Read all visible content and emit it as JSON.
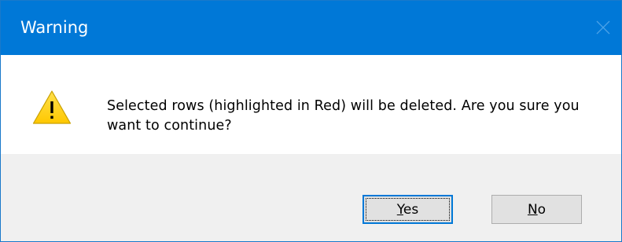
{
  "dialog": {
    "title": "Warning",
    "close_icon": "close-icon",
    "icon": "warning-triangle-icon",
    "message": "Selected rows (highlighted in Red) will be deleted. Are you sure you want to continue?",
    "buttons": {
      "yes": {
        "mnemonic": "Y",
        "rest": "es"
      },
      "no": {
        "mnemonic": "N",
        "rest": "o"
      }
    }
  },
  "colors": {
    "titlebar": "#0078d7",
    "footer": "#f0f0f0",
    "warning_yellow": "#ffcc00"
  }
}
